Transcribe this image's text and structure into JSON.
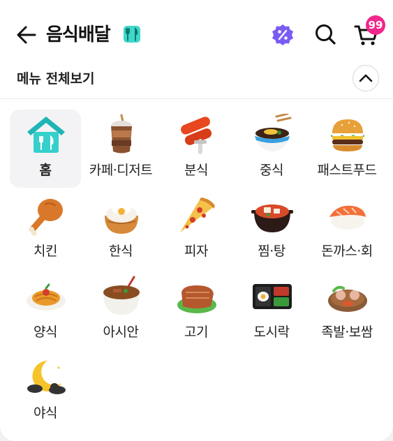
{
  "header": {
    "title": "음식배달",
    "cart_count": "99"
  },
  "section": {
    "title": "메뉴 전체보기"
  },
  "menu": [
    {
      "label": "홈",
      "icon": "home-icon"
    },
    {
      "label": "카페·디저트",
      "icon": "iced-coffee-icon"
    },
    {
      "label": "분식",
      "icon": "tteokbokki-icon"
    },
    {
      "label": "중식",
      "icon": "noodle-bowl-icon"
    },
    {
      "label": "패스트푸드",
      "icon": "burger-icon"
    },
    {
      "label": "치킨",
      "icon": "chicken-leg-icon"
    },
    {
      "label": "한식",
      "icon": "rice-bowl-icon"
    },
    {
      "label": "피자",
      "icon": "pizza-icon"
    },
    {
      "label": "찜·탕",
      "icon": "stew-pot-icon"
    },
    {
      "label": "돈까스·회",
      "icon": "sushi-icon"
    },
    {
      "label": "양식",
      "icon": "pasta-icon"
    },
    {
      "label": "아시안",
      "icon": "pho-icon"
    },
    {
      "label": "고기",
      "icon": "meat-icon"
    },
    {
      "label": "도시락",
      "icon": "lunchbox-icon"
    },
    {
      "label": "족발·보쌈",
      "icon": "pork-plate-icon"
    },
    {
      "label": "야식",
      "icon": "moon-night-icon"
    }
  ],
  "colors": {
    "accent": "#6a4cf0",
    "badge": "#f0288c",
    "home_icon": "#2ec4c4"
  }
}
